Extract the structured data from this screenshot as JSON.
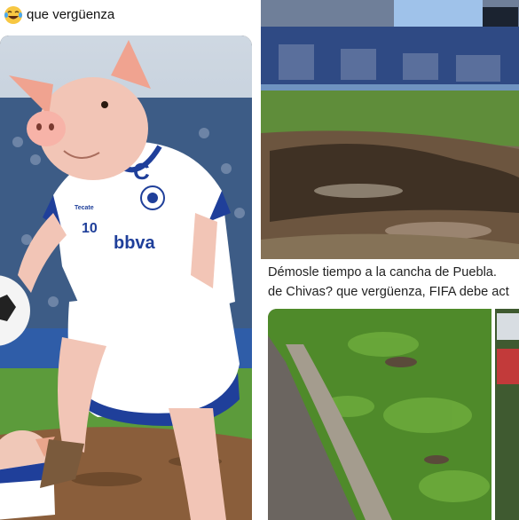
{
  "left_post": {
    "emoji_icon": "laughing-crying-face-icon",
    "text": "que vergüenza",
    "jersey": {
      "brand": "Tecate",
      "logo": "C",
      "number": "10",
      "sponsor": "bbva"
    }
  },
  "right_post": {
    "caption_line1": "Démosle tiempo a la cancha de Puebla.",
    "caption_line2": "de Chivas? que vergüenza, FIFA debe act"
  },
  "colors": {
    "jersey_blue": "#1f3f9a",
    "pig_pink": "#f2c5b6",
    "grass": "#4f8a2a",
    "mud": "#7a5a3c"
  }
}
